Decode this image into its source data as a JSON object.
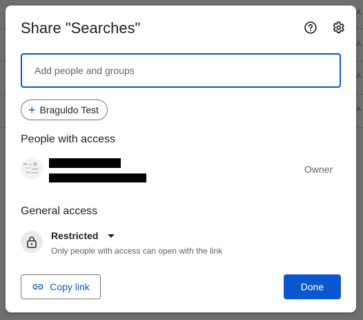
{
  "background": {
    "row_letter": "A"
  },
  "dialog": {
    "title": "Share \"Searches\"",
    "help_icon": "help-circle-icon",
    "settings_icon": "gear-icon"
  },
  "add_people": {
    "placeholder": "Add people and groups",
    "value": ""
  },
  "suggestion_chip": {
    "icon": "plus-icon",
    "label": "Braguldo Test"
  },
  "people_with_access": {
    "heading": "People with access",
    "people": [
      {
        "role": "Owner"
      }
    ]
  },
  "general_access": {
    "heading": "General access",
    "icon": "lock-icon",
    "level": "Restricted",
    "description": "Only people with access can open with the link"
  },
  "footer": {
    "copy_link_label": "Copy link",
    "copy_link_icon": "link-icon",
    "done_label": "Done"
  },
  "colors": {
    "accent": "#0b57d0",
    "backdrop": "#6f6f6f",
    "text": "#1f1f1f",
    "secondary_text": "#5f6368"
  }
}
